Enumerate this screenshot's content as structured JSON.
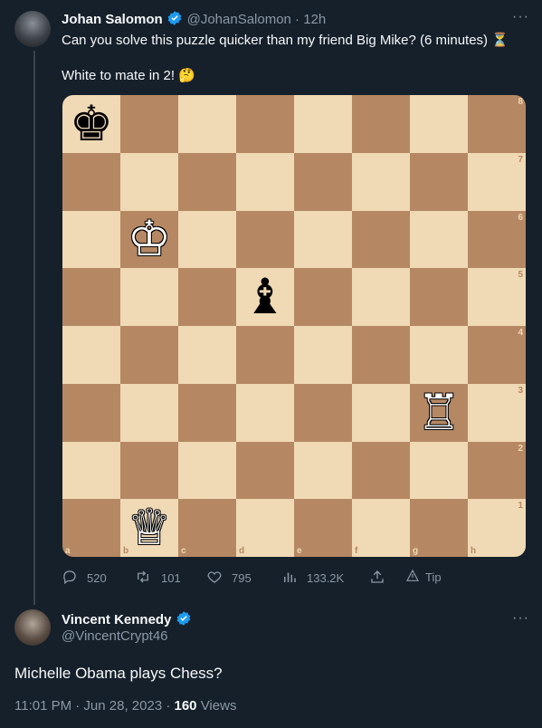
{
  "tweet": {
    "author_name": "Johan Salomon",
    "handle_time": "@JohanSalomon · 12h",
    "line1": "Can you solve this puzzle quicker than my friend Big Mike? (6 minutes) ⏳",
    "line2": "White to mate in 2! 🤔",
    "stats": {
      "replies": "520",
      "retweets": "101",
      "likes": "795",
      "views": "133.2K",
      "tip": "Tip"
    }
  },
  "chess": {
    "files": [
      "a",
      "b",
      "c",
      "d",
      "e",
      "f",
      "g",
      "h"
    ],
    "ranks": [
      "8",
      "7",
      "6",
      "5",
      "4",
      "3",
      "2",
      "1"
    ],
    "pieces": {
      "a8": {
        "glyph": "♚",
        "side": "black",
        "name": "black-king"
      },
      "b6": {
        "glyph": "♔",
        "side": "white",
        "name": "white-king"
      },
      "d5": {
        "glyph": "♝",
        "side": "black",
        "name": "black-bishop"
      },
      "g3": {
        "glyph": "♖",
        "side": "white",
        "name": "white-rook"
      },
      "b1": {
        "glyph": "♕",
        "side": "white",
        "name": "white-queen"
      }
    }
  },
  "reply": {
    "author_name": "Vincent Kennedy",
    "handle": "@VincentCrypt46",
    "text": "Michelle Obama plays Chess?",
    "timestamp": "11:01 PM · Jun 28, 2023 · ",
    "views_count": "160",
    "views_label": " Views"
  },
  "colors": {
    "background": "#15202b",
    "verified": "#1d9bf0",
    "muted": "#8b98a5",
    "board_light": "#f0d9b5",
    "board_dark": "#b58863"
  }
}
